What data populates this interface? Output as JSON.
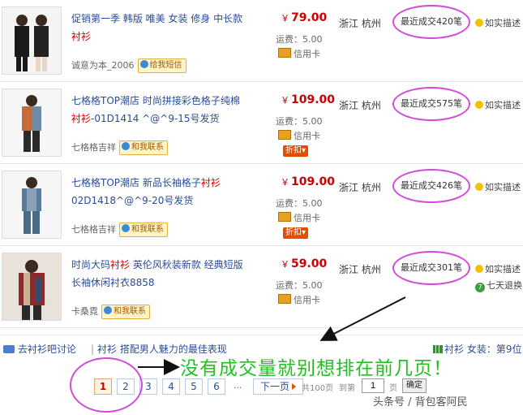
{
  "listings": [
    {
      "title_pre": "促销第一季 韩版 唯美 女装 修身 中长款",
      "title_hl": "衬衫",
      "title_post": "",
      "seller": "诚意为本_2006",
      "contact_label": "给我短信",
      "price": "79.00",
      "currency": "￥",
      "shipping": "运费：5.00",
      "payment": "信用卡",
      "discount": "",
      "location": "浙江 杭州",
      "sold": "最近成交420笔",
      "badge1": "如实描述",
      "badge2": ""
    },
    {
      "title_pre": "七格格TOP潮店 时尚拼接彩色格子纯棉",
      "title_hl": "衬衫",
      "title_post": "-01D1414 ^@^9-15号发货",
      "seller": "七格格吉祥",
      "contact_label": "和我联系",
      "price": "109.00",
      "currency": "￥",
      "shipping": "运费：5.00",
      "payment": "信用卡",
      "discount": "折扣",
      "location": "浙江 杭州",
      "sold": "最近成交575笔",
      "badge1": "如实描述",
      "badge2": ""
    },
    {
      "title_pre": "七格格TOP潮店 新品长袖格子",
      "title_hl": "衬衫",
      "title_post": " 02D1418^@^9-20号发货",
      "seller": "七格格吉祥",
      "contact_label": "和我联系",
      "price": "109.00",
      "currency": "￥",
      "shipping": "运费：5.00",
      "payment": "信用卡",
      "discount": "折扣",
      "location": "浙江 杭州",
      "sold": "最近成交426笔",
      "badge1": "如实描述",
      "badge2": ""
    },
    {
      "title_pre": "时尚大码",
      "title_hl": "衬衫",
      "title_post": " 英伦风秋装新款 经典短版长袖休闲衬衣8858",
      "seller": "卡桑霓",
      "contact_label": "和我联系",
      "price": "59.00",
      "currency": "￥",
      "shipping": "运费：5.00",
      "payment": "信用卡",
      "discount": "",
      "location": "浙江 杭州",
      "sold": "最近成交301笔",
      "badge1": "如实描述",
      "badge2": "七天退换"
    }
  ],
  "bottom_bar": {
    "forum_link": "去衬衫吧讨论",
    "topic_link": "衬衫 搭配男人魅力的最佳表现",
    "right_icon_label": "衬衫",
    "right_link": "女装：第9位"
  },
  "annotation_text": "没有成交量就别想排在前几页！",
  "pager": {
    "pages": [
      "1",
      "2",
      "3",
      "4",
      "5",
      "6"
    ],
    "current_page": "1",
    "ellipsis": "...",
    "next_label": "下一页",
    "total_label": "共100页",
    "goto_label": "到第",
    "goto_value": "1",
    "page_unit": "页",
    "confirm_label": "确定"
  },
  "watermark": "头条号 / 背包客阿民",
  "colors": {
    "link": "#2a4c99",
    "price": "#cc0000",
    "highlight_circle": "#d24ad9",
    "annotation": "#22c022",
    "arrow": "#111111"
  }
}
